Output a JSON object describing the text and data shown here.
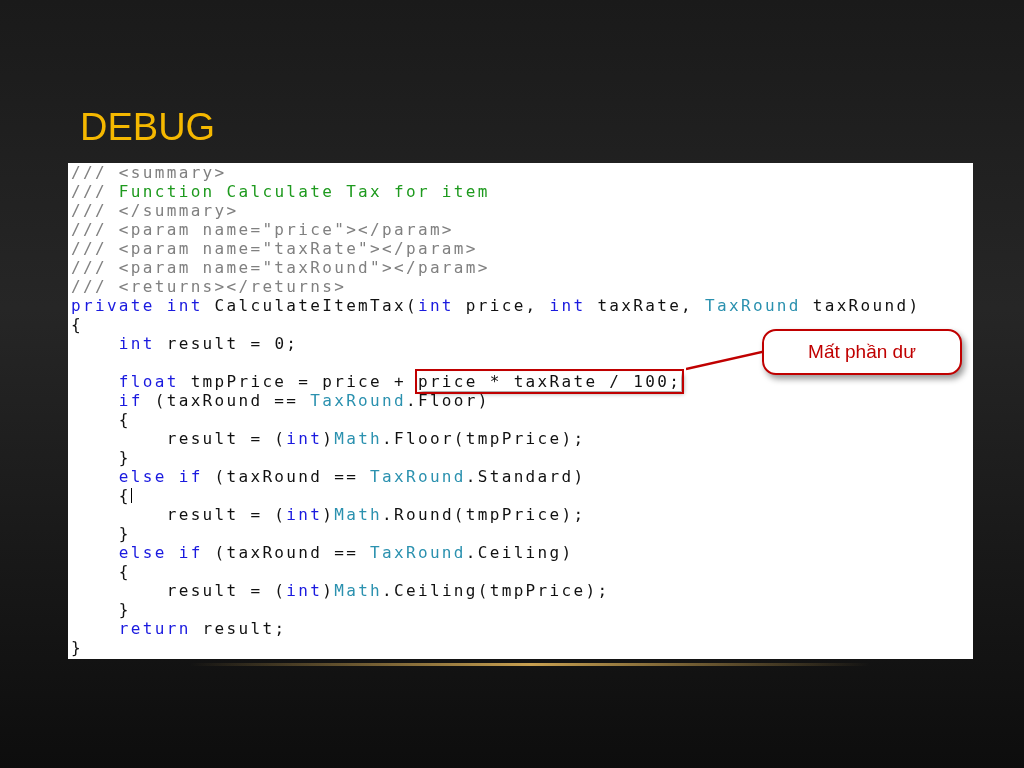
{
  "slide": {
    "title": "DEBUG"
  },
  "code": {
    "lines": [
      {
        "kind": "code",
        "tokens": [
          {
            "text": "/// <summary>",
            "kind": "comment"
          }
        ]
      },
      {
        "kind": "code",
        "tokens": [
          {
            "text": "/// ",
            "kind": "comment"
          },
          {
            "text": "Function Calculate Tax for item",
            "kind": "doc"
          }
        ]
      },
      {
        "kind": "code",
        "tokens": [
          {
            "text": "/// </summary>",
            "kind": "comment"
          }
        ]
      },
      {
        "kind": "code",
        "tokens": [
          {
            "text": "/// <param name=\"price\"></param>",
            "kind": "comment"
          }
        ]
      },
      {
        "kind": "code",
        "tokens": [
          {
            "text": "/// <param name=\"taxRate\"></param>",
            "kind": "comment"
          }
        ]
      },
      {
        "kind": "code",
        "tokens": [
          {
            "text": "/// <param name=\"taxRound\"></param>",
            "kind": "comment"
          }
        ]
      },
      {
        "kind": "code",
        "tokens": [
          {
            "text": "/// <returns></returns>",
            "kind": "comment"
          }
        ]
      },
      {
        "kind": "code",
        "tokens": [
          {
            "text": "private int ",
            "kind": "keyword"
          },
          {
            "text": "CalculateItemTax(",
            "kind": "plain"
          },
          {
            "text": "int",
            "kind": "keyword"
          },
          {
            "text": " price, ",
            "kind": "plain"
          },
          {
            "text": "int",
            "kind": "keyword"
          },
          {
            "text": " taxRate, ",
            "kind": "plain"
          },
          {
            "text": "TaxRound",
            "kind": "type"
          },
          {
            "text": " taxRound)",
            "kind": "plain"
          }
        ]
      },
      {
        "kind": "code",
        "tokens": [
          {
            "text": "{",
            "kind": "plain"
          }
        ]
      },
      {
        "kind": "code",
        "tokens": [
          {
            "text": "    int",
            "kind": "keyword"
          },
          {
            "text": " result = 0;",
            "kind": "plain"
          }
        ]
      },
      {
        "kind": "blank"
      },
      {
        "kind": "code",
        "tokens": [
          {
            "text": "    float",
            "kind": "keyword"
          },
          {
            "text": " tmpPrice = price + ",
            "kind": "plain"
          },
          {
            "text": "price * taxRate / 100;",
            "kind": "plain",
            "boxed": true
          }
        ]
      },
      {
        "kind": "code",
        "tokens": [
          {
            "text": "    if",
            "kind": "keyword"
          },
          {
            "text": " (taxRound == ",
            "kind": "plain"
          },
          {
            "text": "TaxRound",
            "kind": "type"
          },
          {
            "text": ".Floor)",
            "kind": "plain"
          }
        ]
      },
      {
        "kind": "code",
        "tokens": [
          {
            "text": "    {",
            "kind": "plain"
          }
        ]
      },
      {
        "kind": "code",
        "tokens": [
          {
            "text": "        result = (",
            "kind": "plain"
          },
          {
            "text": "int",
            "kind": "keyword"
          },
          {
            "text": ")",
            "kind": "plain"
          },
          {
            "text": "Math",
            "kind": "type"
          },
          {
            "text": ".Floor(tmpPrice);",
            "kind": "plain"
          }
        ]
      },
      {
        "kind": "code",
        "tokens": [
          {
            "text": "    }",
            "kind": "plain"
          }
        ]
      },
      {
        "kind": "code",
        "tokens": [
          {
            "text": "    else if",
            "kind": "keyword"
          },
          {
            "text": " (taxRound == ",
            "kind": "plain"
          },
          {
            "text": "TaxRound",
            "kind": "type"
          },
          {
            "text": ".Standard)",
            "kind": "plain"
          }
        ]
      },
      {
        "kind": "code",
        "caret": true,
        "tokens": [
          {
            "text": "    {",
            "kind": "plain"
          }
        ]
      },
      {
        "kind": "code",
        "tokens": [
          {
            "text": "        result = (",
            "kind": "plain"
          },
          {
            "text": "int",
            "kind": "keyword"
          },
          {
            "text": ")",
            "kind": "plain"
          },
          {
            "text": "Math",
            "kind": "type"
          },
          {
            "text": ".Round(tmpPrice);",
            "kind": "plain"
          }
        ]
      },
      {
        "kind": "code",
        "tokens": [
          {
            "text": "    }",
            "kind": "plain"
          }
        ]
      },
      {
        "kind": "code",
        "tokens": [
          {
            "text": "    else if",
            "kind": "keyword"
          },
          {
            "text": " (taxRound == ",
            "kind": "plain"
          },
          {
            "text": "TaxRound",
            "kind": "type"
          },
          {
            "text": ".Ceiling)",
            "kind": "plain"
          }
        ]
      },
      {
        "kind": "code",
        "tokens": [
          {
            "text": "    {",
            "kind": "plain"
          }
        ]
      },
      {
        "kind": "code",
        "tokens": [
          {
            "text": "        result = (",
            "kind": "plain"
          },
          {
            "text": "int",
            "kind": "keyword"
          },
          {
            "text": ")",
            "kind": "plain"
          },
          {
            "text": "Math",
            "kind": "type"
          },
          {
            "text": ".Ceiling(tmpPrice);",
            "kind": "plain"
          }
        ]
      },
      {
        "kind": "code",
        "tokens": [
          {
            "text": "    }",
            "kind": "plain"
          }
        ]
      },
      {
        "kind": "code",
        "tokens": [
          {
            "text": "    return",
            "kind": "keyword"
          },
          {
            "text": " result;",
            "kind": "plain"
          }
        ]
      },
      {
        "kind": "code",
        "tokens": [
          {
            "text": "}",
            "kind": "plain"
          }
        ]
      }
    ],
    "callout": {
      "text": "Mất phần dư"
    }
  }
}
